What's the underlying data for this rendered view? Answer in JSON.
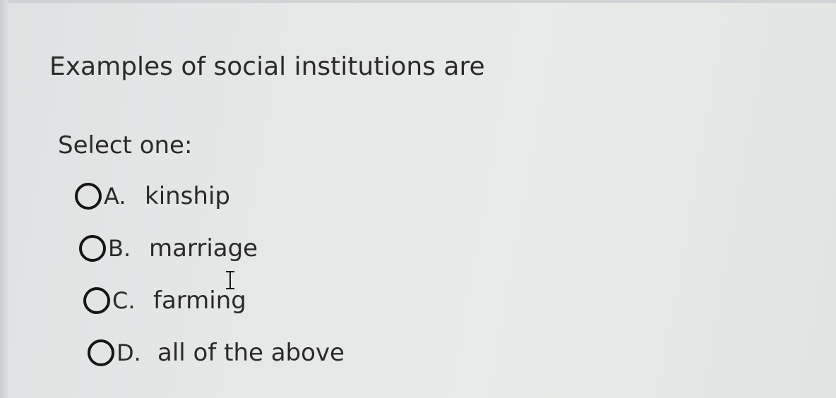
{
  "question": {
    "text": "Examples of social institutions are",
    "prompt": "Select one:"
  },
  "options": [
    {
      "letter": "A.",
      "text": "kinship",
      "selected": false
    },
    {
      "letter": "B.",
      "text": "marriage",
      "selected": false
    },
    {
      "letter": "C.",
      "text": "farming",
      "selected": false
    },
    {
      "letter": "D.",
      "text": "all of the above",
      "selected": false
    }
  ],
  "icons": {
    "radio": "radio-button-icon",
    "cursor": "text-cursor-icon"
  }
}
